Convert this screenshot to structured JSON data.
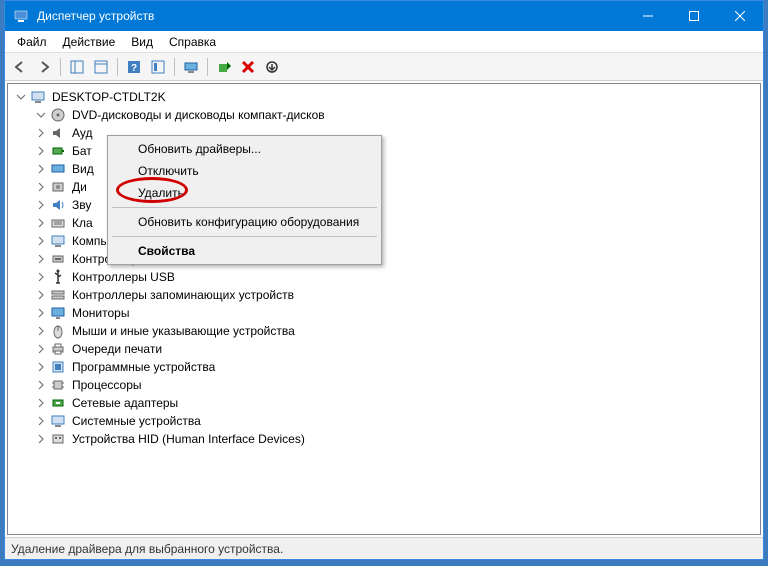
{
  "window": {
    "title": "Диспетчер устройств"
  },
  "menubar": {
    "file": "Файл",
    "action": "Действие",
    "view": "Вид",
    "help": "Справка"
  },
  "tree": {
    "root": "DESKTOP-CTDLT2K",
    "dvd": "DVD-дисководы и дисководы компакт-дисков",
    "audio": "Ауд",
    "battery": "Бат",
    "video": "Вид",
    "disk": "Ди",
    "sound": "Зву",
    "keyboard": "Кла",
    "computer": "Компьютер",
    "ide": "Контроллеры IDE ATA/ATAPI",
    "usb": "Контроллеры USB",
    "storage": "Контроллеры запоминающих устройств",
    "monitors": "Мониторы",
    "mice": "Мыши и иные указывающие устройства",
    "printq": "Очереди печати",
    "software": "Программные устройства",
    "cpu": "Процессоры",
    "network": "Сетевые адаптеры",
    "system": "Системные устройства",
    "hid": "Устройства HID (Human Interface Devices)"
  },
  "context_menu": {
    "update_drivers": "Обновить драйверы...",
    "disable": "Отключить",
    "uninstall": "Удалить",
    "scan_hw": "Обновить конфигурацию оборудования",
    "properties": "Свойства"
  },
  "statusbar": {
    "text": "Удаление драйвера для выбранного устройства."
  }
}
